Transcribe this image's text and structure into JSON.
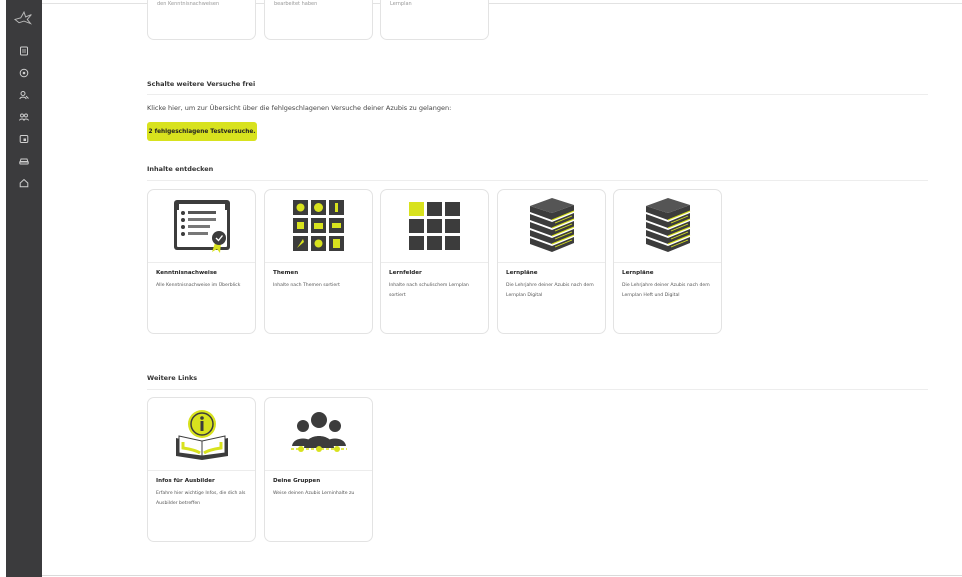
{
  "sidebar": {
    "icons": [
      "logo-bird-icon",
      "document-icon",
      "target-icon",
      "users-icon",
      "group-icon",
      "calendar-icon",
      "car-icon",
      "home-icon"
    ]
  },
  "top_cards": [
    {
      "text": "den Kenntnisnachweisen"
    },
    {
      "text": "bearbeitet haben"
    },
    {
      "text": "Lernplan"
    }
  ],
  "unlock_section": {
    "title": "Schalte weitere Versuche frei",
    "intro": "Klicke hier, um zur Übersicht über die fehlgeschlagenen Versuche deiner Azubis zu gelangen:",
    "button_label": "2 fehlgeschlagene Testversuche."
  },
  "discover_section": {
    "title": "Inhalte entdecken",
    "cards": [
      {
        "title": "Kenntnisnachweise",
        "description": "Alle Kenntnisnachweise im Überblick",
        "icon": "clipboard-icon"
      },
      {
        "title": "Themen",
        "description": "Inhalte nach Themen sortiert",
        "icon": "themes-grid-icon"
      },
      {
        "title": "Lernfelder",
        "description": "Inhalte nach schulischem Lernplan sortiert",
        "icon": "fields-grid-icon"
      },
      {
        "title": "Lernpläne",
        "description": "Die Lehrjahre deiner Azubis nach dem Lernplan Digital",
        "icon": "books-stack-icon"
      },
      {
        "title": "Lernpläne",
        "description": "Die Lehrjahre deiner Azubis nach dem Lernplan Heft und Digital",
        "icon": "books-stack-icon"
      }
    ]
  },
  "links_section": {
    "title": "Weitere Links",
    "cards": [
      {
        "title": "Infos für Ausbilder",
        "description": "Erfahre hier wichtige Infos, die dich als Ausbilder betreffen",
        "icon": "info-book-icon"
      },
      {
        "title": "Deine Gruppen",
        "description": "Weise deinen Azubis Lerninhalte zu",
        "icon": "groups-icon"
      }
    ]
  },
  "colors": {
    "accent": "#d8e21e",
    "sidebar": "#3b3b3d",
    "icon_dark": "#3c3c3c"
  }
}
